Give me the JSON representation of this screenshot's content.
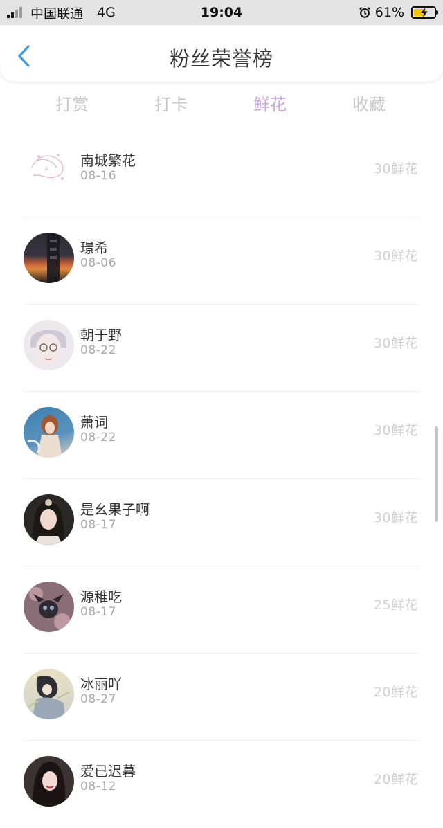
{
  "status_bar": {
    "carrier": "中国联通",
    "network": "4G",
    "time": "19:04",
    "battery_percent": "61%",
    "battery_level": 0.61,
    "icons": [
      "signal-icon",
      "alarm-icon",
      "battery-charging-icon"
    ]
  },
  "header": {
    "title": "粉丝荣誉榜",
    "back_icon": "chevron-left-icon"
  },
  "tabs": [
    {
      "label": "打赏",
      "active": false
    },
    {
      "label": "打卡",
      "active": false
    },
    {
      "label": "鲜花",
      "active": true
    },
    {
      "label": "收藏",
      "active": false
    }
  ],
  "colors": {
    "accent_tab": "#c9a6df",
    "back_arrow": "#3a9be0",
    "battery_fill": "#f2c500"
  },
  "fans": [
    {
      "name": "南城繁花",
      "date": "08-16",
      "amount": "30鲜花"
    },
    {
      "name": "璟希",
      "date": "08-06",
      "amount": "30鲜花"
    },
    {
      "name": "朝于野",
      "date": "08-22",
      "amount": "30鲜花"
    },
    {
      "name": "萧词",
      "date": "08-22",
      "amount": "30鲜花"
    },
    {
      "name": "是幺果子啊",
      "date": "08-17",
      "amount": "30鲜花"
    },
    {
      "name": "源稚吃",
      "date": "08-17",
      "amount": "25鲜花"
    },
    {
      "name": "冰丽吖",
      "date": "08-27",
      "amount": "20鲜花"
    },
    {
      "name": "爱已迟暮",
      "date": "08-12",
      "amount": "20鲜花"
    }
  ]
}
